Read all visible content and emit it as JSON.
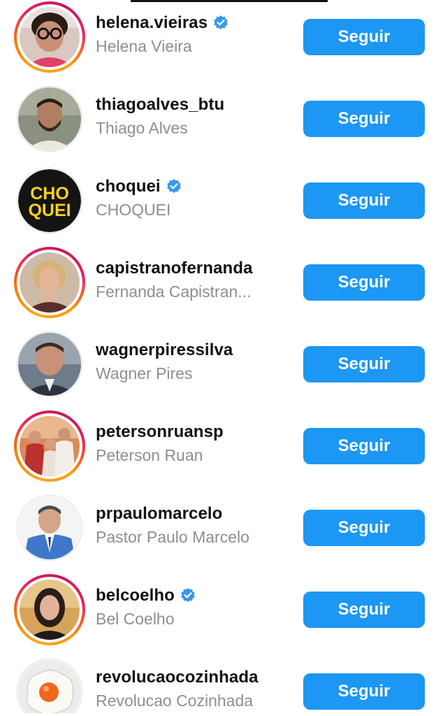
{
  "suggestions": [
    {
      "handle": "helena.vieiras",
      "name": "Helena Vieira",
      "verified": true,
      "story": true,
      "avatar": "person-glasses-avatar",
      "button": "Seguir"
    },
    {
      "handle": "thiagoalves_btu",
      "name": "Thiago Alves",
      "verified": false,
      "story": false,
      "avatar": "bearded-man-avatar",
      "button": "Seguir"
    },
    {
      "handle": "choquei",
      "name": "CHOQUEI",
      "verified": true,
      "story": false,
      "avatar": "choquei-logo-avatar",
      "logo_text": [
        "CHO",
        "QUEI"
      ],
      "button": "Seguir"
    },
    {
      "handle": "capistranofernanda",
      "name": "Fernanda Capistran...",
      "verified": false,
      "story": true,
      "avatar": "blonde-woman-avatar",
      "button": "Seguir"
    },
    {
      "handle": "wagnerpiressilva",
      "name": "Wagner Pires",
      "verified": false,
      "story": false,
      "avatar": "man-suit-avatar",
      "button": "Seguir"
    },
    {
      "handle": "petersonruansp",
      "name": "Peterson Ruan",
      "verified": false,
      "story": true,
      "avatar": "group-photo-avatar",
      "button": "Seguir"
    },
    {
      "handle": "prpaulomarcelo",
      "name": "Pastor Paulo Marcelo",
      "verified": false,
      "story": false,
      "avatar": "man-blue-suit-avatar",
      "button": "Seguir"
    },
    {
      "handle": "belcoelho",
      "name": "Bel Coelho",
      "verified": true,
      "story": true,
      "avatar": "dark-hair-woman-avatar",
      "button": "Seguir"
    },
    {
      "handle": "revolucaocozinhada",
      "name": "Revolucao Cozinhada",
      "verified": false,
      "story": false,
      "avatar": "fried-egg-avatar",
      "button": "Seguir"
    }
  ],
  "colors": {
    "follow_button": "#1c97f3",
    "verified_badge": "#3897f0",
    "secondary_text": "#8e8e8e"
  }
}
